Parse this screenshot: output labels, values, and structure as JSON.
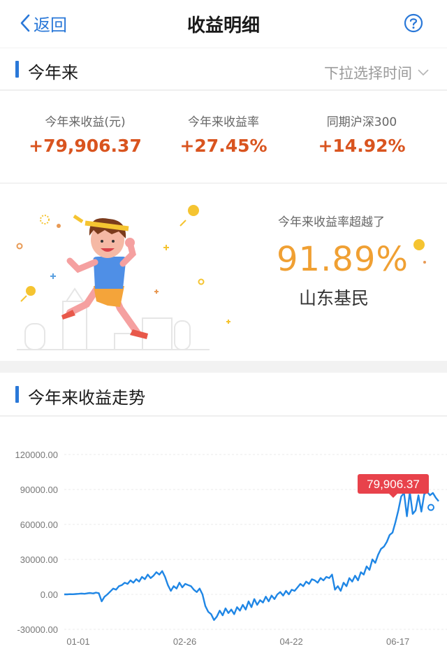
{
  "nav": {
    "back_label": "返回",
    "title": "收益明细",
    "help_icon": "question-circle-icon"
  },
  "period": {
    "title": "今年来",
    "picker_label": "下拉选择时间"
  },
  "stats": [
    {
      "label": "今年来收益(元)",
      "value": "+79,906.37"
    },
    {
      "label": "今年来收益率",
      "value": "+27.45%"
    },
    {
      "label": "同期沪深300",
      "value": "+14.92%"
    }
  ],
  "rank": {
    "label": "今年来收益率超越了",
    "value": "91.89%",
    "region": "山东基民"
  },
  "trend": {
    "title": "今年来收益走势"
  },
  "colors": {
    "accent": "#2a78d8",
    "positive": "#d9541f",
    "rank": "#f0a033",
    "tooltip": "#e8424b"
  },
  "chart_data": {
    "type": "line",
    "title": "今年来收益走势",
    "y_ticks": [
      "120000.00",
      "90000.00",
      "60000.00",
      "30000.00",
      "0.00",
      "-30000.00"
    ],
    "ylim": [
      -30000,
      120000
    ],
    "x_ticks": [
      "01-01",
      "02-26",
      "04-22",
      "06-17"
    ],
    "grid": true,
    "tooltip_label": "79,906.37",
    "x_index_range": [
      0,
      130
    ],
    "series": [
      {
        "values": [
          0,
          0,
          200,
          100,
          300,
          500,
          700,
          500,
          900,
          1200,
          800,
          1500,
          1000,
          -6000,
          -2000,
          0,
          2500,
          5000,
          4000,
          7000,
          8000,
          10000,
          9000,
          12000,
          10000,
          13000,
          11000,
          15000,
          13000,
          17000,
          14000,
          16000,
          19000,
          17000,
          20000,
          15000,
          8000,
          3000,
          7000,
          5000,
          10000,
          6000,
          9000,
          8000,
          7000,
          4000,
          2000,
          5000,
          0,
          -10000,
          -15000,
          -17000,
          -22000,
          -19000,
          -14000,
          -18000,
          -12000,
          -16000,
          -13000,
          -17000,
          -11000,
          -14000,
          -9000,
          -13000,
          -6000,
          -11000,
          -4000,
          -9000,
          -5000,
          -7000,
          -2000,
          -6000,
          -1000,
          -4000,
          0,
          2000,
          -1000,
          3000,
          0,
          4000,
          3000,
          6000,
          9000,
          7000,
          11000,
          9000,
          13000,
          12000,
          10000,
          14000,
          12000,
          15000,
          14000,
          17000,
          4000,
          7000,
          3000,
          10000,
          7000,
          14000,
          11000,
          16000,
          12000,
          19000,
          17000,
          24000,
          21000,
          30000,
          27000,
          34000,
          39000,
          41000,
          45000,
          51000,
          53000,
          62000,
          72000,
          84000,
          87000,
          67000,
          88000,
          69000,
          72000,
          85000,
          71000,
          86000,
          88000,
          85000,
          87000,
          83000,
          80000
        ]
      }
    ]
  }
}
